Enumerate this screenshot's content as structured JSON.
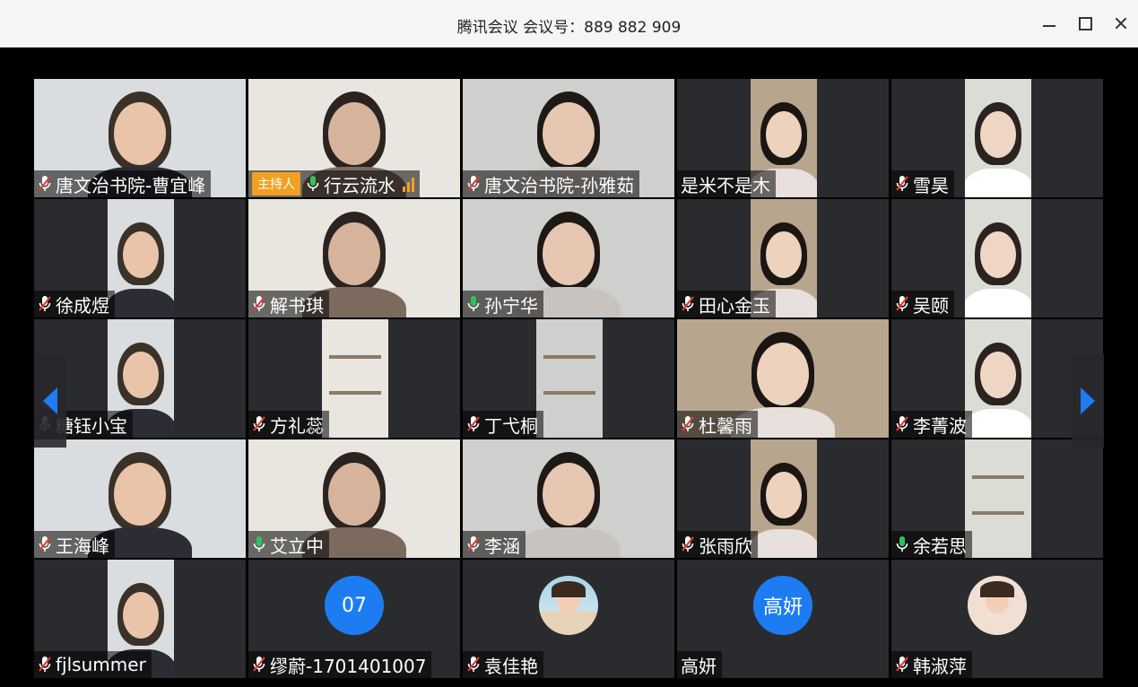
{
  "window": {
    "title": "腾讯会议 会议号：889 882 909",
    "controls": [
      "minimize-icon",
      "maximize-icon",
      "close-icon"
    ]
  },
  "host_badge": "主持人",
  "participants": [
    {
      "name": "唐文治书院-曹宜峰",
      "mic": "muted",
      "type": "video",
      "scene": "office"
    },
    {
      "name": "行云流水",
      "mic": "on",
      "type": "video",
      "scene": "hand",
      "host": true,
      "signal": true
    },
    {
      "name": "唐文治书院-孙雅茹",
      "mic": "muted",
      "type": "video",
      "scene": "room"
    },
    {
      "name": "是米不是木",
      "mic": "none",
      "type": "video",
      "scene": "narrow"
    },
    {
      "name": "雪昊",
      "mic": "muted",
      "type": "video",
      "scene": "narrow"
    },
    {
      "name": "徐成煜",
      "mic": "muted",
      "type": "video",
      "scene": "narrow"
    },
    {
      "name": "解书琪",
      "mic": "muted",
      "type": "video",
      "scene": "wide"
    },
    {
      "name": "孙宁华",
      "mic": "on",
      "type": "video",
      "scene": "wide"
    },
    {
      "name": "田心金玉",
      "mic": "muted",
      "type": "video",
      "scene": "narrow"
    },
    {
      "name": "吴颐",
      "mic": "muted",
      "type": "video",
      "scene": "narrow"
    },
    {
      "name": "糖钰小宝",
      "mic": "muted",
      "type": "video",
      "scene": "narrow"
    },
    {
      "name": "方礼蕊",
      "mic": "muted",
      "type": "video",
      "scene": "narrow-empty"
    },
    {
      "name": "丁弋桐",
      "mic": "muted",
      "type": "video",
      "scene": "narrow-empty"
    },
    {
      "name": "杜馨雨",
      "mic": "muted",
      "type": "video",
      "scene": "wide"
    },
    {
      "name": "李菁波",
      "mic": "muted",
      "type": "video",
      "scene": "narrow"
    },
    {
      "name": "王海峰",
      "mic": "muted",
      "type": "video",
      "scene": "wide"
    },
    {
      "name": "艾立中",
      "mic": "on",
      "type": "video",
      "scene": "wide"
    },
    {
      "name": "李涵",
      "mic": "muted",
      "type": "video",
      "scene": "wide"
    },
    {
      "name": "张雨欣",
      "mic": "muted",
      "type": "video",
      "scene": "narrow"
    },
    {
      "name": "余若思",
      "mic": "on",
      "type": "video",
      "scene": "narrow-empty"
    },
    {
      "name": "fjlsummer",
      "mic": "muted",
      "type": "video",
      "scene": "narrow"
    },
    {
      "name": "缪蔚-1701401007",
      "mic": "muted",
      "type": "avatar",
      "avatar_text": "07"
    },
    {
      "name": "袁佳艳",
      "mic": "muted",
      "type": "photo-avatar"
    },
    {
      "name": "高妍",
      "mic": "none",
      "type": "avatar",
      "avatar_text": "高妍"
    },
    {
      "name": "韩淑萍",
      "mic": "muted",
      "type": "photo-avatar"
    }
  ],
  "colors": {
    "accent": "#1e7cf2",
    "host_badge": "#f2a022",
    "mic_on": "#2fc25b",
    "tile_bg": "#2a2b2e"
  },
  "nav": {
    "left": "chevron-left-icon",
    "right": "chevron-right-icon"
  }
}
